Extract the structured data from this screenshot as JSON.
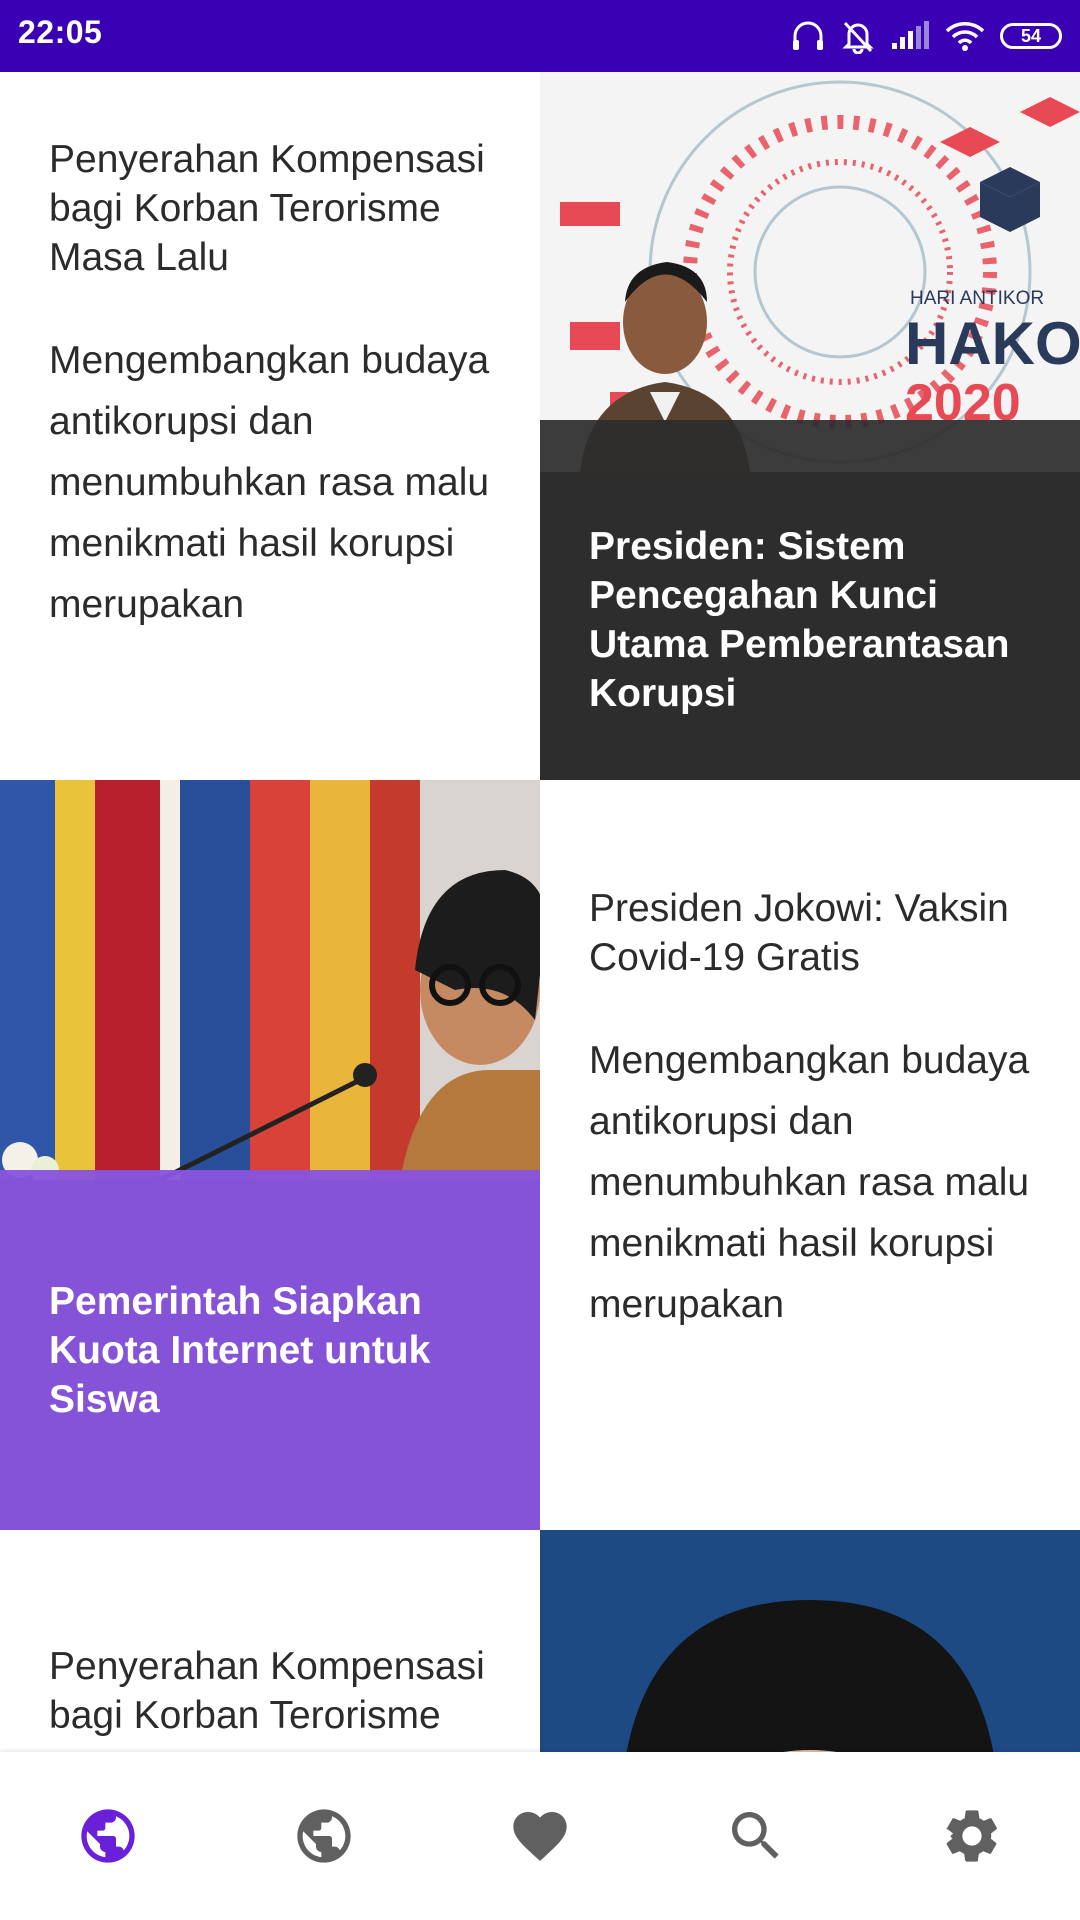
{
  "status_bar": {
    "time": "22:05",
    "battery": "54",
    "icons": [
      "headphones-icon",
      "bell-off-icon",
      "signal-icon",
      "wifi-icon",
      "battery-icon"
    ]
  },
  "news": [
    {
      "type": "text",
      "title": "Penyerahan Kompensasi bagi Korban Terorisme Masa Lalu",
      "body": "Mengembangkan budaya antikorupsi dan menumbuhkan rasa malu menikmati hasil korupsi merupakan"
    },
    {
      "type": "image",
      "title": "Presiden: Sistem Pencegahan Kunci Utama Pemberantasan Korupsi",
      "image_caption": "HARI ANTIKOR HAKO 2020",
      "overlay_color": "#2d2d2d"
    },
    {
      "type": "image",
      "title": "Pemerintah Siapkan Kuota Internet untuk Siswa",
      "overlay_color": "#8854de"
    },
    {
      "type": "text",
      "title": "Presiden Jokowi: Vaksin Covid-19 Gratis",
      "body": "Mengembangkan budaya antikorupsi dan menumbuhkan rasa malu menikmati hasil korupsi merupakan"
    },
    {
      "type": "text",
      "title": "Penyerahan Kompensasi bagi Korban Terorisme"
    },
    {
      "type": "image"
    }
  ],
  "nav": {
    "active_color": "#6a1fd8",
    "inactive_color": "#606060",
    "items": [
      "globe-icon-active",
      "globe-icon",
      "heart-icon",
      "search-icon",
      "gear-icon"
    ]
  }
}
